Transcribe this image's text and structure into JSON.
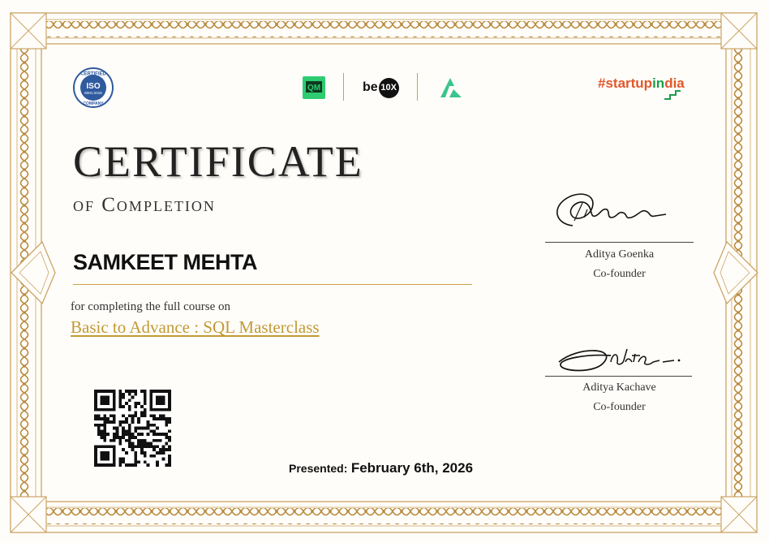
{
  "badges": {
    "iso_top": "CERTIFIED",
    "iso_main": "ISO",
    "iso_number": "9001:2015",
    "iso_bottom": "COMPANY"
  },
  "partners": {
    "om_logo": "QM",
    "be_text": "be",
    "be_circle": "10X",
    "startup_prefix": "#startup",
    "startup_in": "in",
    "startup_suffix": "dia"
  },
  "certificate": {
    "title": "CERTIFICATE",
    "subtitle": "of Completion",
    "recipient": "SAMKEET MEHTA",
    "completing_text": "for completing the full course on",
    "course_name": "Basic to Advance : SQL Masterclass",
    "presented_label": "Presented:",
    "presented_date": "February 6th, 2026"
  },
  "signatories": [
    {
      "name": "Aditya Goenka",
      "role": "Co-founder"
    },
    {
      "name": "Aditya Kachave",
      "role": "Co-founder"
    }
  ],
  "colors": {
    "gold": "#c9a24a",
    "course_gold": "#c19a35",
    "startup_orange": "#e2572c",
    "startup_green": "#1e9c4c",
    "iso_blue": "#2f5a9e"
  },
  "icons": {
    "iso": "iso-certified-badge-icon",
    "om": "om-logo-icon",
    "arrow": "green-arrow-logo-icon",
    "qr": "qr-code-icon"
  }
}
